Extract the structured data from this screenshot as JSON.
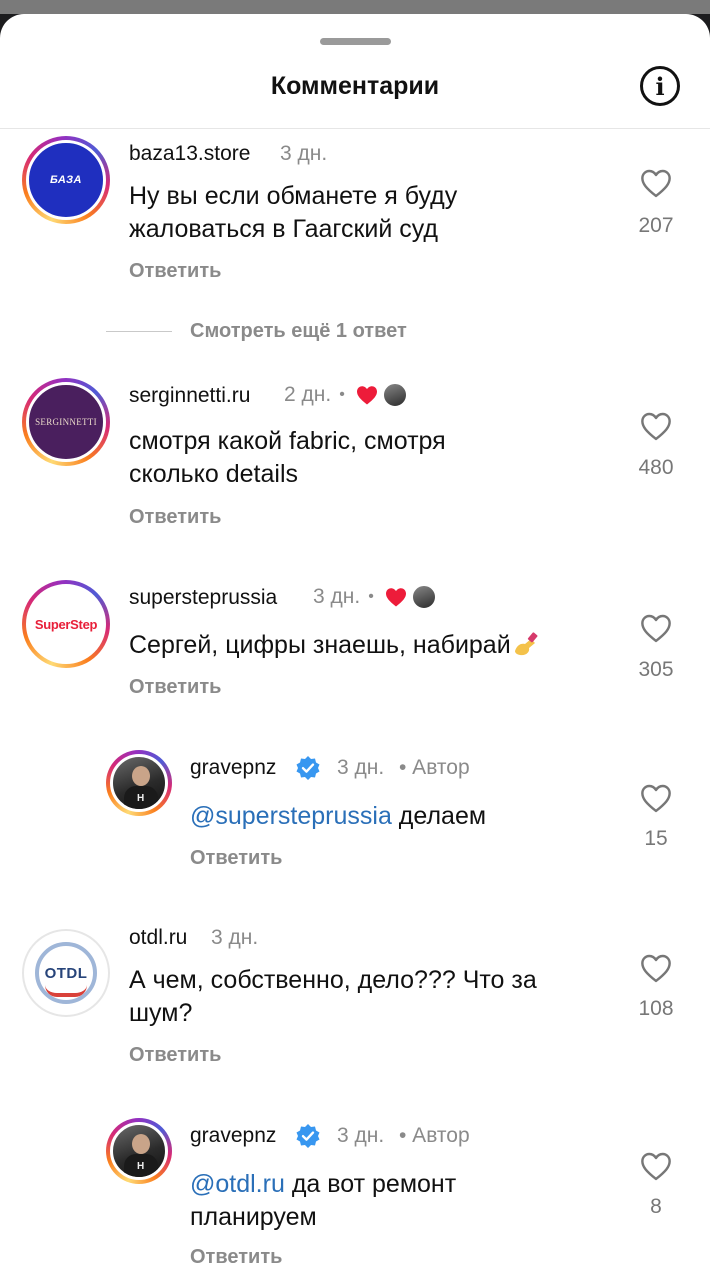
{
  "header": {
    "title": "Комментарии",
    "info_icon": "info-icon",
    "info_glyph": "i"
  },
  "comments": [
    {
      "user": "baza13.store",
      "time": "3 дн.",
      "text_lines": [
        "Ну вы если обманете я буду",
        "жаловаться в Гаагский суд"
      ],
      "reply_label": "Ответить",
      "likes": "207",
      "avatar_text": "БАЗА"
    },
    {
      "user": "serginnetti.ru",
      "time": "2 дн.",
      "dot": "•",
      "text_lines": [
        "смотря какой fabric, смотря",
        "сколько details"
      ],
      "reply_label": "Ответить",
      "likes": "480",
      "avatar_text": "SERGINNETTI"
    },
    {
      "user": "supersteprussia",
      "time": "3 дн.",
      "dot": "•",
      "text": "Сергей, цифры знаешь, набирай",
      "reply_label": "Ответить",
      "likes": "305",
      "avatar_text": "SuperStep"
    },
    {
      "user": "gravepnz",
      "time": "3 дн.",
      "author": "• Автор",
      "mention": "@supersteprussia",
      "text": " делаем",
      "reply_label": "Ответить",
      "likes": "15",
      "avatar_mark": "H"
    },
    {
      "user": "otdl.ru",
      "time": "3 дн.",
      "text_lines": [
        "А чем, собственно, дело??? Что за",
        "шум?"
      ],
      "reply_label": "Ответить",
      "likes": "108",
      "avatar_text": "OTDL"
    },
    {
      "user": "gravepnz",
      "time": "3 дн.",
      "author": "• Автор",
      "mention": "@otdl.ru",
      "text": " да вот ремонт",
      "text_line2": "планируем",
      "reply_label": "Ответить",
      "likes": "8",
      "avatar_mark": "H"
    }
  ],
  "view_more": "Смотреть ещё 1 ответ",
  "colors": {
    "sheet": "#ffffff",
    "mention": "#2a6fb8",
    "muted": "#8a8a8a",
    "like_heart_red": "#ed1c3a",
    "verified_blue": "#3897f0"
  }
}
